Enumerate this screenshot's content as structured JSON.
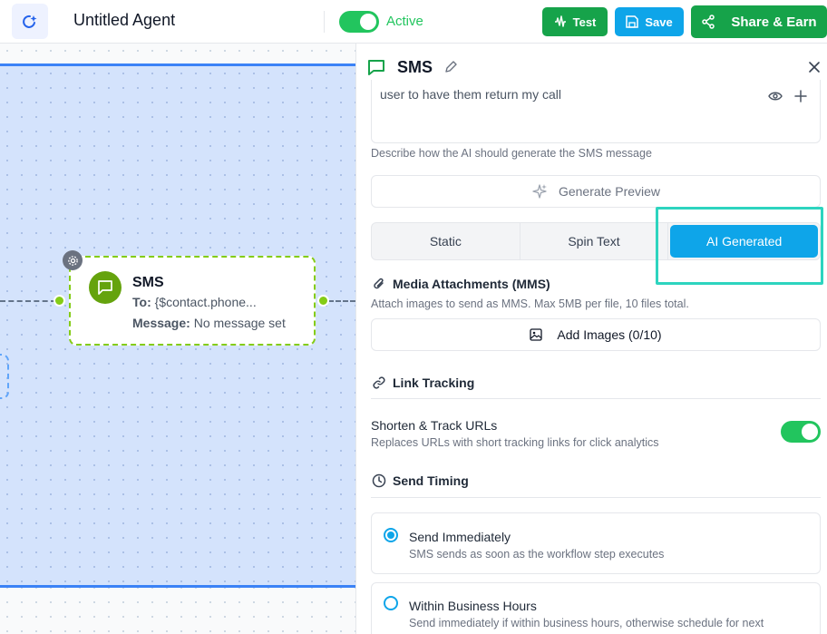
{
  "header": {
    "agent_title": "Untitled Agent",
    "active_label": "Active",
    "test_label": "Test",
    "save_label": "Save",
    "share_label": "Share & Earn",
    "active_toggle_on": true
  },
  "canvas": {
    "node": {
      "title": "SMS",
      "to_label": "To:",
      "to_value": "{$contact.phone...",
      "message_label": "Message:",
      "message_value": "No message set"
    }
  },
  "panel": {
    "title": "SMS",
    "prompt_text": "user to have them return my call",
    "prompt_helper": "Describe how the AI should generate the SMS message",
    "generate_preview_label": "Generate Preview",
    "mode_tabs": [
      {
        "label": "Static",
        "active": false
      },
      {
        "label": "Spin Text",
        "active": false
      },
      {
        "label": "AI Generated",
        "active": true
      }
    ],
    "media": {
      "title": "Media Attachments (MMS)",
      "helper": "Attach images to send as MMS. Max 5MB per file, 10 files total.",
      "add_label": "Add Images (0/10)"
    },
    "link_tracking": {
      "title": "Link Tracking",
      "shorten_label": "Shorten & Track URLs",
      "shorten_helper": "Replaces URLs with short tracking links for click analytics",
      "shorten_on": true
    },
    "send_timing": {
      "title": "Send Timing",
      "options": [
        {
          "label": "Send Immediately",
          "description": "SMS sends as soon as the workflow step executes",
          "checked": true
        },
        {
          "label": "Within Business Hours",
          "description": "Send immediately if within business hours, otherwise schedule for next",
          "checked": false
        }
      ]
    }
  },
  "colors": {
    "green": "#16a34a",
    "blue": "#0ea5e9",
    "node_border": "#84cc16",
    "highlight": "#2dd4bf"
  }
}
